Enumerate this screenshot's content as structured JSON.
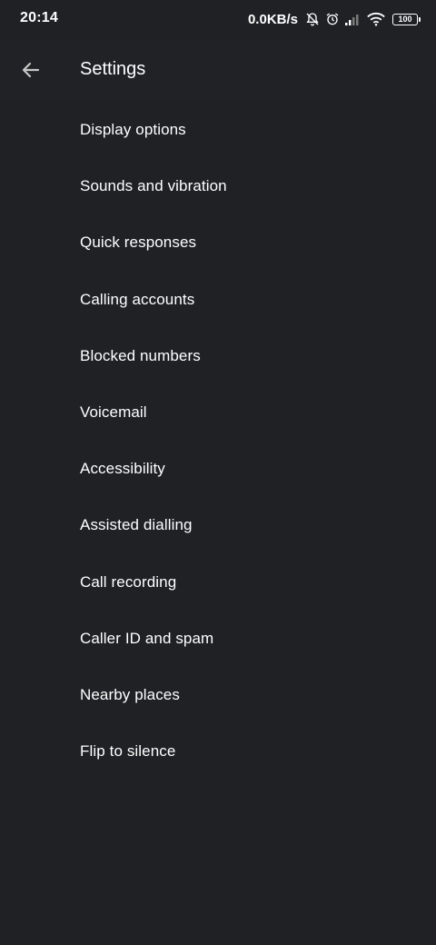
{
  "status_bar": {
    "time": "20:14",
    "net_speed": "0.0KB/s",
    "battery_level": "100",
    "icons": [
      "notifications-off-icon",
      "alarm-icon",
      "signal-icon",
      "wifi-icon",
      "battery-icon"
    ]
  },
  "app_bar": {
    "back_icon": "arrow-back-icon",
    "title": "Settings"
  },
  "settings": {
    "items": [
      {
        "label": "Display options"
      },
      {
        "label": "Sounds and vibration"
      },
      {
        "label": "Quick responses"
      },
      {
        "label": "Calling accounts"
      },
      {
        "label": "Blocked numbers"
      },
      {
        "label": "Voicemail"
      },
      {
        "label": "Accessibility"
      },
      {
        "label": "Assisted dialling"
      },
      {
        "label": "Call recording"
      },
      {
        "label": "Caller ID and spam"
      },
      {
        "label": "Nearby places"
      },
      {
        "label": "Flip to silence"
      }
    ]
  },
  "colors": {
    "background": "#202125",
    "text": "#ffffff",
    "icon": "#c4c7c5"
  }
}
